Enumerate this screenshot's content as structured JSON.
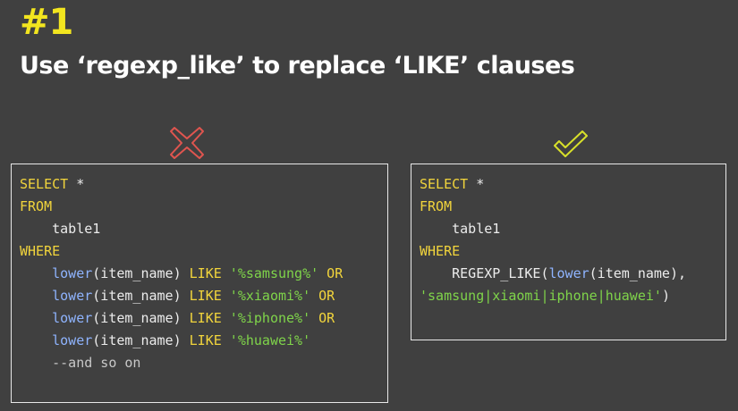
{
  "heading": {
    "number": "#1",
    "title": "Use ‘regexp_like’ to replace ‘LIKE’ clauses"
  },
  "colors": {
    "background": "#404040",
    "accent_yellow": "#f2e51f",
    "bad_mark": "#e0554f",
    "good_mark": "#d8e02a",
    "keyword": "#f2d53c",
    "function": "#8fb4ff",
    "string": "#7fd44a"
  },
  "icons": {
    "bad": "cross-icon",
    "good": "check-icon"
  },
  "bad_example": {
    "select": "SELECT",
    "star": " *",
    "from": "FROM",
    "table": "    table1",
    "where": "WHERE",
    "conditions": [
      {
        "indent": "    ",
        "fn": "lower",
        "arg": "(item_name) ",
        "op": "LIKE",
        "str": " '%samsung%'",
        "join": " OR"
      },
      {
        "indent": "    ",
        "fn": "lower",
        "arg": "(item_name) ",
        "op": "LIKE",
        "str": " '%xiaomi%'",
        "join": " OR"
      },
      {
        "indent": "    ",
        "fn": "lower",
        "arg": "(item_name) ",
        "op": "LIKE",
        "str": " '%iphone%'",
        "join": " OR"
      },
      {
        "indent": "    ",
        "fn": "lower",
        "arg": "(item_name) ",
        "op": "LIKE",
        "str": " '%huawei%'",
        "join": ""
      }
    ],
    "comment": "    --and so on"
  },
  "good_example": {
    "select": "SELECT",
    "star": " *",
    "from": "FROM",
    "table": "    table1",
    "where": "WHERE",
    "call_prefix": "    REGEXP_LIKE(",
    "call_fn": "lower",
    "call_arg": "(item_name),",
    "pattern": "'samsung|xiaomi|iphone|huawei'",
    "close": ")"
  }
}
